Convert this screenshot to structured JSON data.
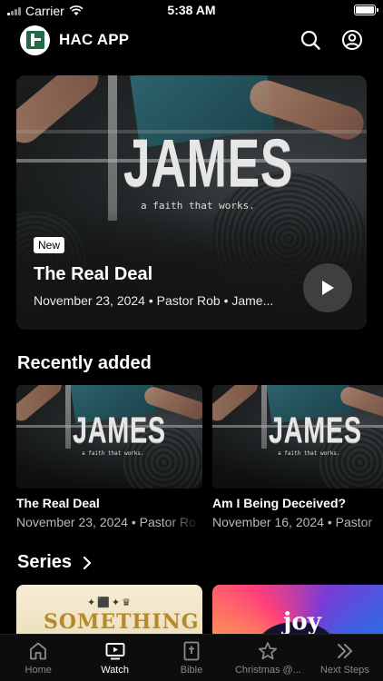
{
  "status_bar": {
    "carrier": "Carrier",
    "time": "5:38 AM"
  },
  "header": {
    "app_name": "HAC APP",
    "icons": [
      "search-icon",
      "account-icon"
    ]
  },
  "hero": {
    "art_title": "JAMES",
    "art_tagline": "a faith that works.",
    "badge": "New",
    "title": "The Real Deal",
    "meta": "November 23, 2024 • Pastor Rob • Jame..."
  },
  "recent": {
    "heading": "Recently added",
    "items": [
      {
        "art_title": "JAMES",
        "art_tagline": "a faith that works.",
        "title": "The Real Deal",
        "meta": "November 23, 2024 • Pastor Ro"
      },
      {
        "art_title": "JAMES",
        "art_tagline": "a faith that works.",
        "title": "Am I Being Deceived?",
        "meta": "November 16, 2024 • Pastor"
      }
    ]
  },
  "series": {
    "heading": "Series",
    "items": [
      {
        "art_title": "SOMETHING",
        "ornament": "✦⬛✦♛"
      },
      {
        "art_title": "joy"
      }
    ]
  },
  "tabs": [
    {
      "label": "Home",
      "icon": "home-icon",
      "active": false
    },
    {
      "label": "Watch",
      "icon": "tv-play-icon",
      "active": true
    },
    {
      "label": "Bible",
      "icon": "bible-icon",
      "active": false
    },
    {
      "label": "Christmas @...",
      "icon": "star-icon",
      "active": false
    },
    {
      "label": "Next Steps",
      "icon": "chevrons-right-icon",
      "active": false
    }
  ]
}
